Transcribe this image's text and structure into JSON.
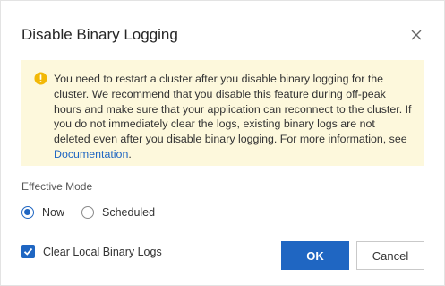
{
  "dialog": {
    "title": "Disable Binary Logging",
    "close_icon": "close-icon"
  },
  "alert": {
    "icon": "warning-icon",
    "text": "You need to restart a cluster after you disable binary logging for the cluster. We recommend that you disable this feature during off-peak hours and make sure that your application can reconnect to the cluster. If you do not immediately clear the logs, existing binary logs are not deleted even after you disable binary logging. For more information, see ",
    "link_text": "Documentation",
    "suffix": "."
  },
  "effective_mode": {
    "label": "Effective Mode",
    "options": [
      {
        "label": "Now",
        "selected": true
      },
      {
        "label": "Scheduled",
        "selected": false
      }
    ]
  },
  "clear_logs": {
    "label": "Clear Local Binary Logs",
    "checked": true
  },
  "buttons": {
    "ok_label": "OK",
    "cancel_label": "Cancel"
  },
  "colors": {
    "accent": "#1f66c2",
    "alert_bg": "#fdf8dc",
    "warning": "#f2b807"
  }
}
